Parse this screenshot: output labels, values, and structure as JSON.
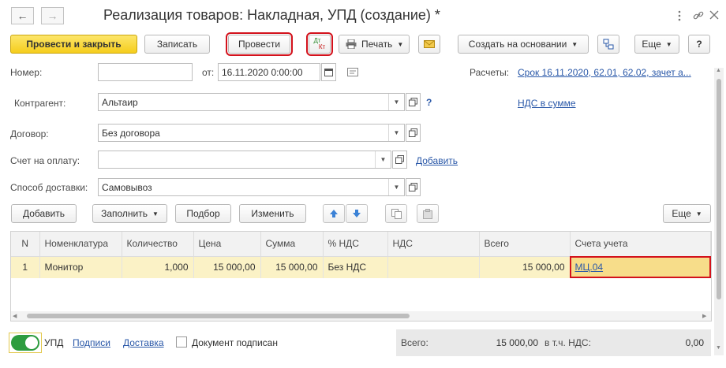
{
  "window": {
    "title": "Реализация товаров: Накладная, УПД (создание) *",
    "back_icon": "←",
    "forward_icon": "→"
  },
  "toolbar": {
    "post_close_label": "Провести и закрыть",
    "write_label": "Записать",
    "post_label": "Провести",
    "dtkt_top": "Дт",
    "dtkt_bottom": "Кт",
    "print_label": "Печать",
    "create_based_label": "Создать на основании",
    "more_label": "Еще",
    "help_label": "?"
  },
  "header": {
    "number_label": "Номер:",
    "number_value": "",
    "date_label": "от:",
    "date_value": "16.11.2020  0:00:00",
    "payments_label": "Расчеты:",
    "payments_link": "Срок 16.11.2020, 62.01, 62.02, зачет а...",
    "contractor_label": "Контрагент:",
    "contractor_value": "Альтаир",
    "help_q": "?",
    "vat_link": "НДС в сумме",
    "contract_label": "Договор:",
    "contract_value": "Без договора",
    "invoice_label": "Счет на оплату:",
    "invoice_value": "",
    "add_link": "Добавить",
    "delivery_label": "Способ доставки:",
    "delivery_value": "Самовывоз"
  },
  "table_toolbar": {
    "add_label": "Добавить",
    "fill_label": "Заполнить",
    "select_label": "Подбор",
    "change_label": "Изменить",
    "more_label": "Еще"
  },
  "table": {
    "columns": [
      "N",
      "Номенклатура",
      "Количество",
      "Цена",
      "Сумма",
      "% НДС",
      "НДС",
      "Всего",
      "Счета учета"
    ],
    "rows": [
      {
        "n": "1",
        "item": "Монитор",
        "qty": "1,000",
        "price": "15 000,00",
        "sum": "15 000,00",
        "vat_rate": "Без НДС",
        "vat": "",
        "total": "15 000,00",
        "account": "МЦ.04"
      }
    ]
  },
  "footer": {
    "upd_label": "УПД",
    "signatures_link": "Подписи",
    "delivery_link": "Доставка",
    "signed_label": "Документ подписан",
    "total_label": "Всего:",
    "total_value": "15 000,00",
    "vat_incl_label": "в т.ч. НДС:",
    "vat_value": "0,00"
  },
  "colors": {
    "primary": "#f5cd1c",
    "highlight_frame": "#d3121c",
    "link": "#2a58a8",
    "row_selected": "#fbf2c6",
    "toggle_on": "#2d9c3f"
  }
}
